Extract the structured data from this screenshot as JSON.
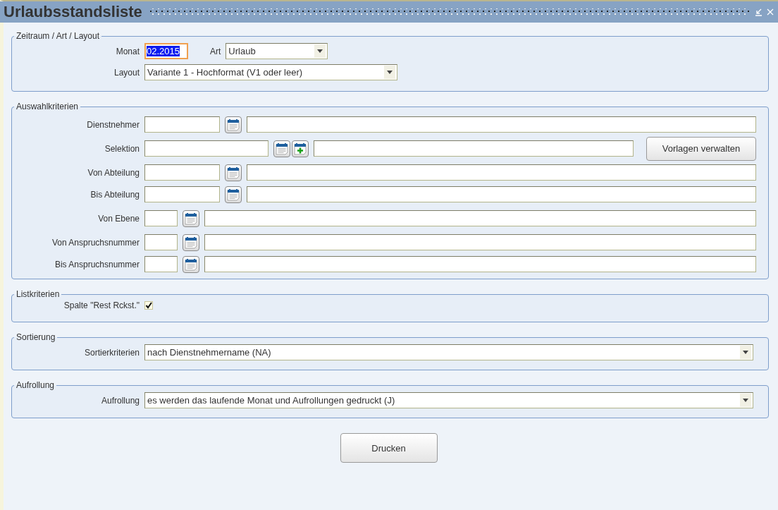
{
  "window": {
    "title": "Urlaubsstandsliste"
  },
  "period": {
    "legend": "Zeitraum / Art / Layout",
    "month": {
      "label": "Monat",
      "value": "02.2015",
      "highlighted": true
    },
    "type": {
      "label": "Art",
      "value": "Urlaub"
    },
    "layout": {
      "label": "Layout",
      "value": "Variante 1 - Hochformat (V1 oder leer)"
    }
  },
  "criteria": {
    "legend": "Auswahlkriterien",
    "groups": [
      [
        {
          "label": "Dienstnehmer",
          "kind": "medium",
          "buttons": [
            {
              "kind": "lookup"
            }
          ]
        }
      ],
      [
        {
          "label": "Selektion",
          "kind": "long",
          "buttons": [
            {
              "kind": "lookup"
            },
            {
              "kind": "add"
            }
          ],
          "button": "Vorlagen verwalten"
        }
      ],
      [
        {
          "label": "Von Abteilung",
          "kind": "medium",
          "buttons": [
            {
              "kind": "lookup"
            }
          ]
        },
        {
          "label": "Bis Abteilung",
          "kind": "medium",
          "buttons": [
            {
              "kind": "lookup"
            }
          ]
        }
      ],
      [
        {
          "label": "Von Ebene",
          "kind": "short",
          "buttons": [
            {
              "kind": "lookup"
            }
          ]
        }
      ],
      [
        {
          "label": "Von Anspruchsnummer",
          "kind": "short",
          "buttons": [
            {
              "kind": "lookup"
            }
          ]
        },
        {
          "label": "Bis Anspruchsnummer",
          "kind": "short",
          "buttons": [
            {
              "kind": "lookup"
            }
          ]
        }
      ]
    ]
  },
  "list": {
    "legend": "Listkriterien",
    "label": "Spalte \"Rest Rckst.\"",
    "checked": true
  },
  "sorting": {
    "legend": "Sortierung",
    "label": "Sortierkriterien",
    "value": "nach Dienstnehmername (NA)"
  },
  "rollup": {
    "legend": "Aufrollung",
    "label": "Aufrollung",
    "value": "es werden das laufende Monat und Aufrollungen gedruckt (J)"
  },
  "print_button": "Drucken"
}
